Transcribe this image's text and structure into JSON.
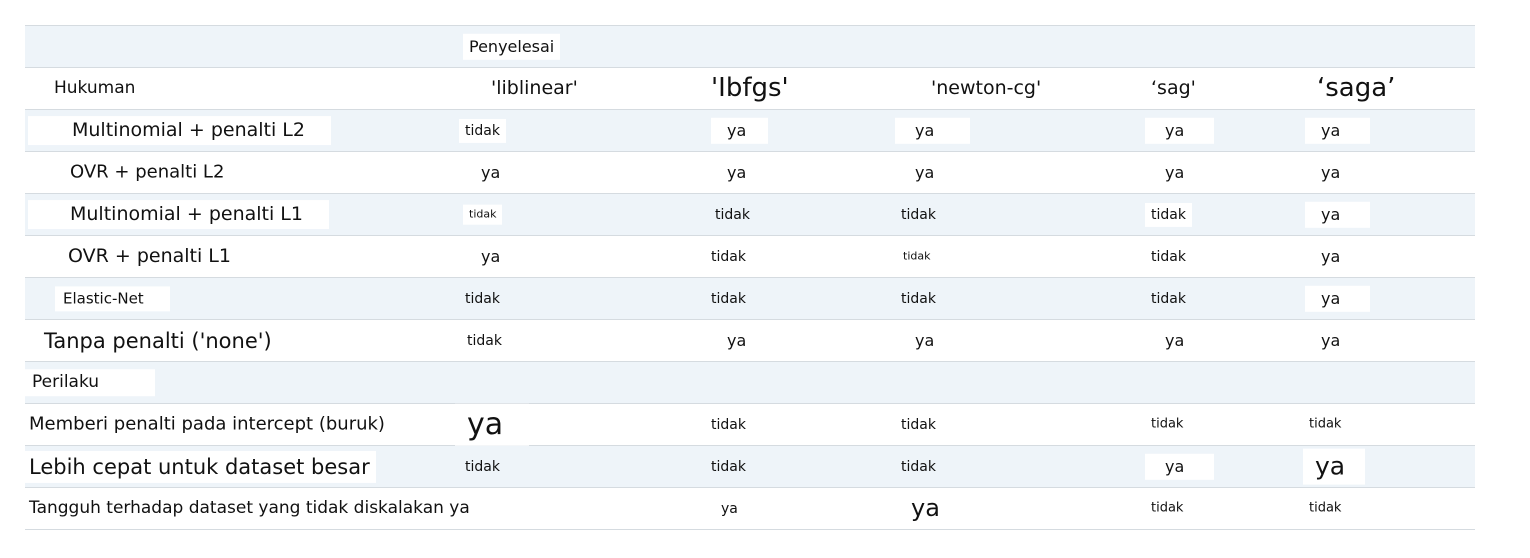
{
  "solver_group_label": "Penyelesai",
  "penalty_header": "Hukuman",
  "solvers": [
    "'liblinear'",
    "'Ibfgs'",
    "'newton-cg'",
    "‘sag'",
    "‘saga’"
  ],
  "behavior_label": "Perilaku",
  "penalty_rows": [
    {
      "label": "Multinomial + penalti L2",
      "values": [
        "tidak",
        "ya",
        "ya",
        "ya",
        "ya"
      ]
    },
    {
      "label": "OVR + penalti L2",
      "values": [
        "ya",
        "ya",
        "ya",
        "ya",
        "ya"
      ]
    },
    {
      "label": "Multinomial + penalti L1",
      "values": [
        "tidak",
        "tidak",
        "tidak",
        "tidak",
        "ya"
      ]
    },
    {
      "label": "OVR + penalti L1",
      "values": [
        "ya",
        "tidak",
        "tidak",
        "tidak",
        "ya"
      ]
    },
    {
      "label": "Elastic-Net",
      "values": [
        "tidak",
        "tidak",
        "tidak",
        "tidak",
        "ya"
      ]
    },
    {
      "label": "Tanpa penalti ('none')",
      "values": [
        "tidak",
        "ya",
        "ya",
        "ya",
        "ya"
      ]
    }
  ],
  "behavior_rows": [
    {
      "label": "Memberi penalti pada intercept (buruk)",
      "values": [
        "ya",
        "tidak",
        "tidak",
        "tidak",
        "tidak"
      ]
    },
    {
      "label": "Lebih cepat untuk dataset besar",
      "values": [
        "tidak",
        "tidak",
        "tidak",
        "ya",
        "ya"
      ]
    },
    {
      "label": "Tangguh terhadap dataset yang tidak diskalakan ya",
      "values": [
        "",
        "ya",
        "ya",
        "tidak",
        "tidak"
      ]
    }
  ]
}
